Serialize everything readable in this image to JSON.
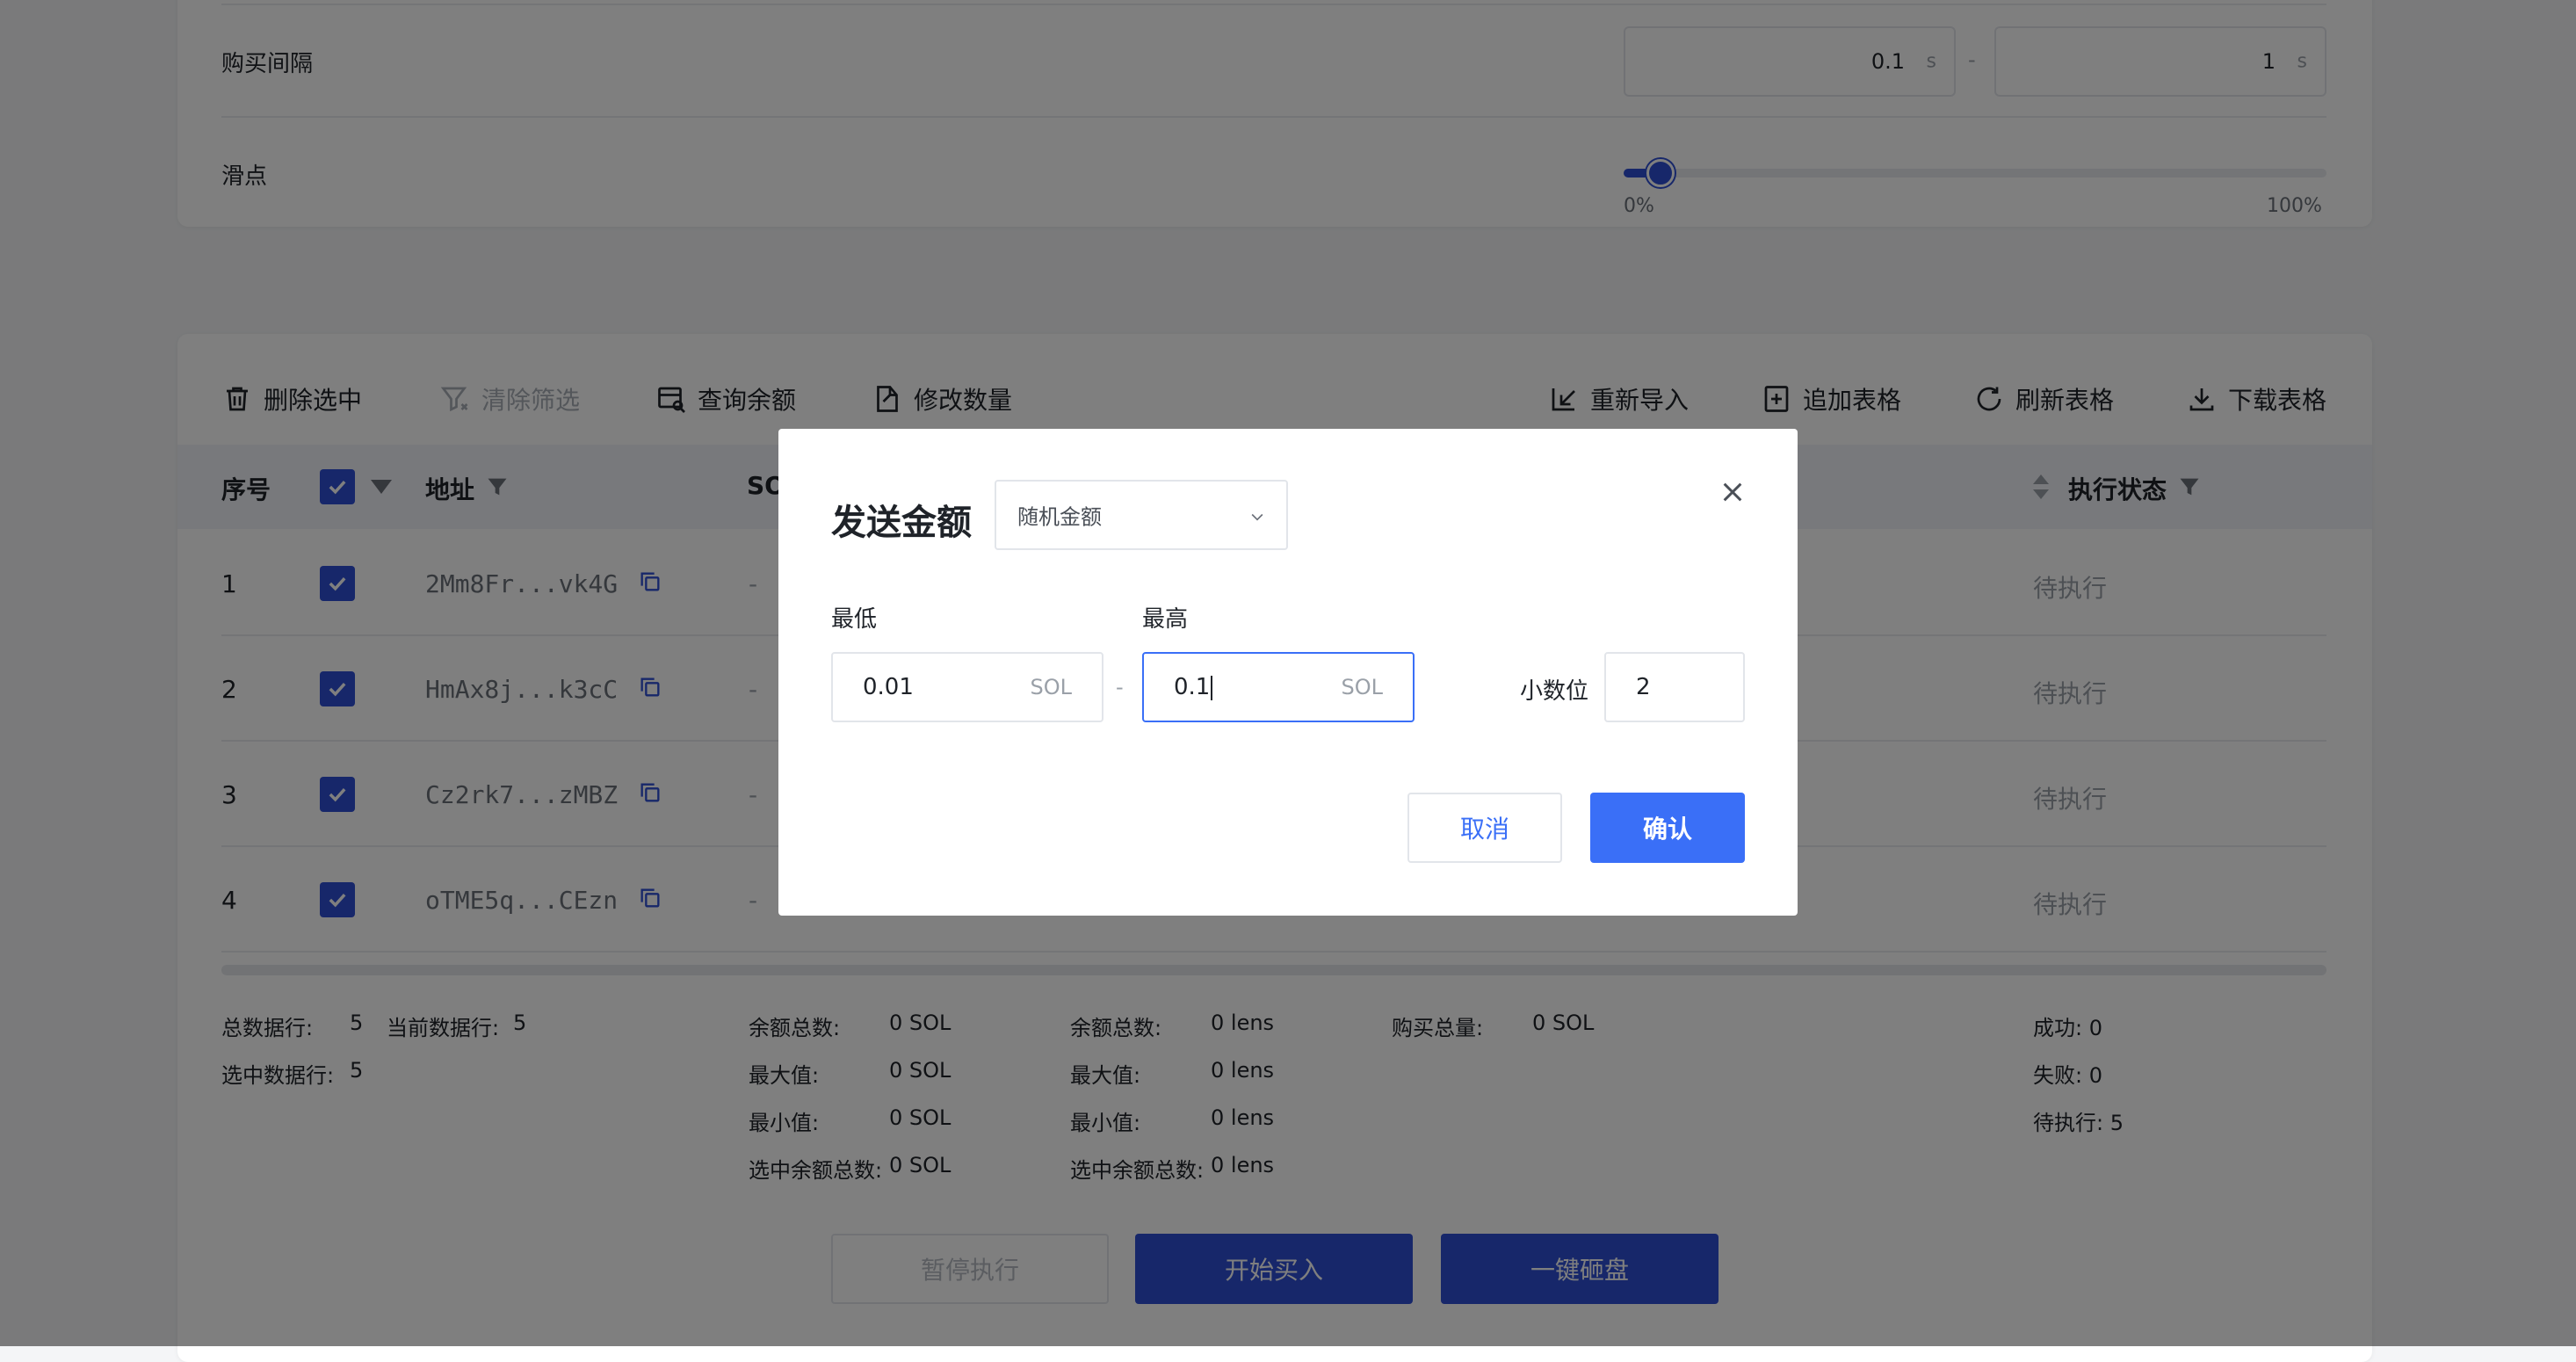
{
  "settings": {
    "interval_label": "购买间隔",
    "interval_min": "0.1",
    "interval_max": "1",
    "interval_unit": "s",
    "interval_dash": "-",
    "slippage_label": "滑点",
    "slippage_value_fraction": 0.05,
    "slippage_min_label": "0%",
    "slippage_max_label": "100%"
  },
  "toolbar": {
    "delete_selected": "删除选中",
    "clear_filter": "清除筛选",
    "query_balance": "查询余额",
    "modify_quantity": "修改数量",
    "reimport": "重新导入",
    "append_table": "追加表格",
    "refresh_table": "刷新表格",
    "download_table": "下载表格"
  },
  "table": {
    "headers": {
      "index": "序号",
      "address": "地址",
      "sol_partial": "SO",
      "status": "执行状态"
    },
    "rows": [
      {
        "index": "1",
        "address": "2Mm8Fr...vk4G",
        "sol": "-",
        "status": "待执行"
      },
      {
        "index": "2",
        "address": "HmAx8j...k3cC",
        "sol": "-",
        "status": "待执行"
      },
      {
        "index": "3",
        "address": "Cz2rk7...zMBZ",
        "sol": "-",
        "status": "待执行"
      },
      {
        "index": "4",
        "address": "oTME5q...CEzn",
        "sol": "-",
        "status": "待执行"
      }
    ]
  },
  "stats": {
    "total_rows_label": "总数据行:",
    "total_rows": "5",
    "current_rows_label": "当前数据行:",
    "current_rows": "5",
    "selected_rows_label": "选中数据行:",
    "selected_rows": "5",
    "sol": [
      {
        "label": "余额总数:",
        "value": "0 SOL"
      },
      {
        "label": "最大值:",
        "value": "0 SOL"
      },
      {
        "label": "最小值:",
        "value": "0 SOL"
      },
      {
        "label": "选中余额总数:",
        "value": "0 SOL"
      }
    ],
    "lens": [
      {
        "label": "余额总数:",
        "value": "0 lens"
      },
      {
        "label": "最大值:",
        "value": "0 lens"
      },
      {
        "label": "最小值:",
        "value": "0 lens"
      },
      {
        "label": "选中余额总数:",
        "value": "0 lens"
      }
    ],
    "buy_total_label": "购买总量:",
    "buy_total": "0 SOL",
    "success": "成功: 0",
    "failed": "失败: 0",
    "pending": "待执行: 5"
  },
  "actions": {
    "pause": "暂停执行",
    "start_buy": "开始买入",
    "dump_all": "一键砸盘"
  },
  "modal": {
    "title": "发送金额",
    "mode_select": "随机金额",
    "min_label": "最低",
    "max_label": "最高",
    "min_value": "0.01",
    "max_value": "0.1",
    "unit": "SOL",
    "range_dash": "-",
    "decimals_label": "小数位",
    "decimals_value": "2",
    "cancel": "取消",
    "confirm": "确认"
  },
  "colors": {
    "primary": "#2e4fd4",
    "confirm": "#3a6ff7",
    "overlay": "rgba(0,0,0,0.5)"
  }
}
